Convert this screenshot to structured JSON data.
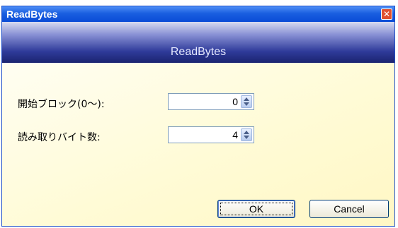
{
  "window": {
    "title": "ReadBytes",
    "close_glyph": "✕"
  },
  "banner": {
    "title": "ReadBytes"
  },
  "fields": [
    {
      "label": "開始ブロック(0〜):",
      "value": "0"
    },
    {
      "label": "読み取りバイト数:",
      "value": "4"
    }
  ],
  "buttons": {
    "ok": "OK",
    "cancel": "Cancel"
  },
  "colors": {
    "titlebar": "#0a4bd6",
    "banner_dark": "#1b2470",
    "content_bg": "#fffbd6"
  },
  "icons": {
    "close": "close-icon",
    "spin_up": "spin-up-arrow-icon",
    "spin_down": "spin-down-arrow-icon"
  }
}
